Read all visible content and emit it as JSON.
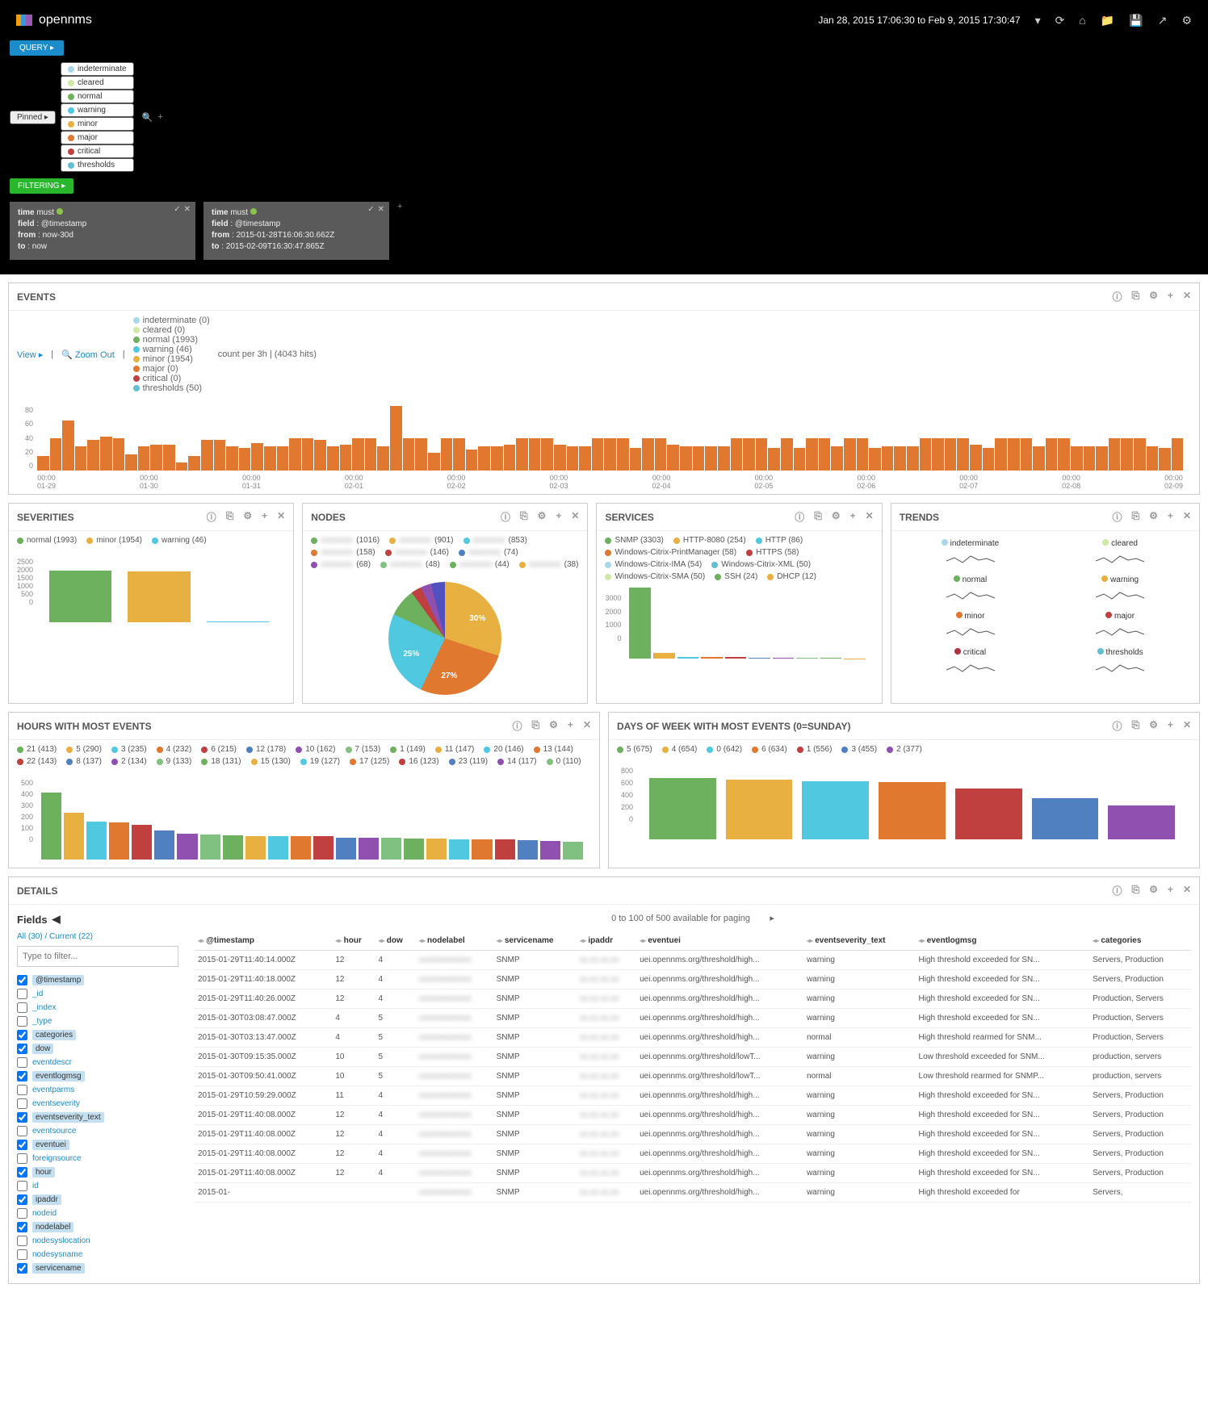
{
  "header": {
    "brand": "opennms",
    "time_range": "Jan 28, 2015 17:06:30 to Feb 9, 2015 17:30:47"
  },
  "buttons": {
    "query": "QUERY ▸",
    "filtering": "FILTERING ▸",
    "pinned": "Pinned ▸"
  },
  "severity_pills": [
    {
      "label": "indeterminate",
      "cls": "d-indet"
    },
    {
      "label": "cleared",
      "cls": "d-clear"
    },
    {
      "label": "normal",
      "cls": "d-norm"
    },
    {
      "label": "warning",
      "cls": "d-warn"
    },
    {
      "label": "minor",
      "cls": "d-minor"
    },
    {
      "label": "major",
      "cls": "d-major"
    },
    {
      "label": "critical",
      "cls": "d-crit"
    },
    {
      "label": "thresholds",
      "cls": "d-thresh"
    }
  ],
  "filters": [
    {
      "title": "time",
      "mode": "must",
      "lines": [
        [
          "field",
          "@timestamp"
        ],
        [
          "from",
          "now-30d"
        ],
        [
          "to",
          "now"
        ]
      ]
    },
    {
      "title": "time",
      "mode": "must",
      "lines": [
        [
          "field",
          "@timestamp"
        ],
        [
          "from",
          "2015-01-28T16:06:30.662Z"
        ],
        [
          "to",
          "2015-02-09T16:30:47.865Z"
        ]
      ]
    }
  ],
  "events_panel": {
    "title": "EVENTS",
    "view": "View ▸",
    "zoom": "🔍 Zoom Out",
    "legend": [
      {
        "label": "indeterminate (0)",
        "cls": "d-indet"
      },
      {
        "label": "cleared (0)",
        "cls": "d-clear"
      },
      {
        "label": "normal (1993)",
        "cls": "d-norm"
      },
      {
        "label": "warning (46)",
        "cls": "d-warn"
      },
      {
        "label": "minor (1954)",
        "cls": "d-minor"
      },
      {
        "label": "major (0)",
        "cls": "d-major"
      },
      {
        "label": "critical (0)",
        "cls": "d-crit"
      },
      {
        "label": "thresholds (50)",
        "cls": "d-thresh"
      }
    ],
    "count_text": "count per 3h | (4043 hits)"
  },
  "chart_data": {
    "events_timeline": {
      "type": "bar",
      "ylim": [
        0,
        80
      ],
      "yticks": [
        0,
        20,
        40,
        60,
        80
      ],
      "xticks": [
        "00:00",
        "01-29",
        "00:00",
        "01-30",
        "00:00",
        "01-31",
        "00:00",
        "02-01",
        "00:00",
        "02-02",
        "00:00",
        "02-03",
        "00:00",
        "02-04",
        "00:00",
        "02-05",
        "00:00",
        "02-06",
        "00:00",
        "02-07",
        "00:00",
        "02-08",
        "00:00",
        "02-09"
      ],
      "bars": [
        18,
        40,
        62,
        30,
        38,
        42,
        40,
        20,
        30,
        32,
        32,
        10,
        18,
        38,
        38,
        30,
        28,
        34,
        30,
        30,
        40,
        40,
        38,
        30,
        32,
        40,
        40,
        30,
        80,
        40,
        40,
        22,
        40,
        40,
        26,
        30,
        30,
        32,
        40,
        40,
        40,
        32,
        30,
        30,
        40,
        40,
        40,
        28,
        40,
        40,
        32,
        30,
        30,
        30,
        30,
        40,
        40,
        40,
        28,
        40,
        28,
        40,
        40,
        30,
        40,
        40,
        28,
        30,
        30,
        30,
        40,
        40,
        40,
        40,
        32,
        28,
        40,
        40,
        40,
        30,
        40,
        40,
        30,
        30,
        30,
        40,
        40,
        40,
        30,
        28,
        40
      ]
    },
    "severities": {
      "type": "bar",
      "ylim": [
        0,
        2500
      ],
      "yticks": [
        0,
        500,
        1000,
        1500,
        2000,
        2500
      ],
      "legend": [
        {
          "label": "normal (1993)",
          "cls": "d-norm"
        },
        {
          "label": "minor (1954)",
          "cls": "d-minor"
        },
        {
          "label": "warning (46)",
          "cls": "d-warn"
        }
      ],
      "series": [
        {
          "label": "normal",
          "value": 1993,
          "color": "#6db05d"
        },
        {
          "label": "minor",
          "value": 1954,
          "color": "#e8b040"
        },
        {
          "label": "warning",
          "value": 46,
          "color": "#50c8e0"
        }
      ]
    },
    "nodes": {
      "type": "pie",
      "legend": [
        "(1016)",
        "(901)",
        "(853)",
        "(158)",
        "(146)",
        "(74)",
        "(68)",
        "(48)",
        "(44)",
        "(38)"
      ],
      "slices": [
        {
          "pct": 30
        },
        {
          "pct": 27
        },
        {
          "pct": 25
        }
      ]
    },
    "services": {
      "type": "bar",
      "ylim": [
        0,
        3000
      ],
      "yticks": [
        0,
        1000,
        2000,
        3000
      ],
      "legend": [
        {
          "label": "SNMP (3303)",
          "cls": "d-norm"
        },
        {
          "label": "HTTP-8080 (254)",
          "cls": "d-minor"
        },
        {
          "label": "HTTP (86)",
          "cls": "d-warn"
        },
        {
          "label": "Windows-Citrix-PrintManager (58)",
          "cls": "d-major"
        },
        {
          "label": "HTTPS (58)",
          "cls": "d-crit"
        },
        {
          "label": "Windows-Citrix-IMA (54)",
          "cls": "d-indet"
        },
        {
          "label": "Windows-Citrix-XML (50)",
          "cls": "d-thresh"
        },
        {
          "label": "Windows-Citrix-SMA (50)",
          "cls": "d-clear"
        },
        {
          "label": "SSH (24)",
          "cls": "d-norm"
        },
        {
          "label": "DHCP (12)",
          "cls": "d-minor"
        }
      ],
      "series": [
        3303,
        254,
        86,
        58,
        58,
        54,
        50,
        50,
        24,
        12
      ],
      "colors": [
        "#6db05d",
        "#e8b040",
        "#50c8e0",
        "#e07830",
        "#c04040",
        "#5080c0",
        "#9050b0",
        "#80c080",
        "#6db05d",
        "#e8b040"
      ]
    },
    "hours": {
      "type": "bar",
      "ylim": [
        0,
        500
      ],
      "yticks": [
        0,
        100,
        200,
        300,
        400,
        500
      ],
      "legend": [
        "21 (413)",
        "5 (290)",
        "3 (235)",
        "4 (232)",
        "6 (215)",
        "12 (178)",
        "10 (162)",
        "7 (153)",
        "1 (149)",
        "11 (147)",
        "20 (146)",
        "13 (144)",
        "22 (143)",
        "8 (137)",
        "2 (134)",
        "9 (133)",
        "18 (131)",
        "15 (130)",
        "19 (127)",
        "17 (125)",
        "16 (123)",
        "23 (119)",
        "14 (117)",
        "0 (110)"
      ],
      "values": [
        413,
        290,
        235,
        232,
        215,
        178,
        162,
        153,
        149,
        147,
        146,
        144,
        143,
        137,
        134,
        133,
        131,
        130,
        127,
        125,
        123,
        119,
        117,
        110
      ],
      "colors": [
        "#6db05d",
        "#e8b040",
        "#50c8e0",
        "#e07830",
        "#c04040",
        "#5080c0",
        "#9050b0",
        "#80c080",
        "#6db05d",
        "#e8b040",
        "#50c8e0",
        "#e07830",
        "#c04040",
        "#5080c0",
        "#9050b0",
        "#80c080",
        "#6db05d",
        "#e8b040",
        "#50c8e0",
        "#e07830",
        "#c04040",
        "#5080c0",
        "#9050b0",
        "#80c080"
      ]
    },
    "dow": {
      "type": "bar",
      "ylim": [
        0,
        800
      ],
      "yticks": [
        0,
        200,
        400,
        600,
        800
      ],
      "legend": [
        {
          "label": "5 (675)"
        },
        {
          "label": "4 (654)"
        },
        {
          "label": "0 (642)"
        },
        {
          "label": "6 (634)"
        },
        {
          "label": "1 (556)"
        },
        {
          "label": "3 (455)"
        },
        {
          "label": "2 (377)"
        }
      ],
      "values": [
        675,
        654,
        642,
        634,
        556,
        455,
        377
      ],
      "colors": [
        "#6db05d",
        "#e8b040",
        "#50c8e0",
        "#e07830",
        "#c04040",
        "#5080c0",
        "#9050b0"
      ]
    },
    "trends": [
      "indeterminate",
      "cleared",
      "normal",
      "warning",
      "minor",
      "major",
      "critical",
      "thresholds"
    ]
  },
  "panels": {
    "severities": "SEVERITIES",
    "nodes": "NODES",
    "services": "SERVICES",
    "trends": "TRENDS",
    "hours": "HOURS WITH MOST EVENTS",
    "dow": "DAYS OF WEEK WITH MOST EVENTS (0=SUNDAY)",
    "details": "DETAILS"
  },
  "details": {
    "pager": "0 to 100 of 500 available for paging",
    "fields_title": "Fields",
    "fields_links": "All (30) / Current (22)",
    "filter_placeholder": "Type to filter...",
    "fields": [
      {
        "name": "@timestamp",
        "sel": true
      },
      {
        "name": "_id",
        "sel": false
      },
      {
        "name": "_index",
        "sel": false
      },
      {
        "name": "_type",
        "sel": false
      },
      {
        "name": "categories",
        "sel": true
      },
      {
        "name": "dow",
        "sel": true
      },
      {
        "name": "eventdescr",
        "sel": false
      },
      {
        "name": "eventlogmsg",
        "sel": true
      },
      {
        "name": "eventparms",
        "sel": false
      },
      {
        "name": "eventseverity",
        "sel": false
      },
      {
        "name": "eventseverity_text",
        "sel": true
      },
      {
        "name": "eventsource",
        "sel": false
      },
      {
        "name": "eventuei",
        "sel": true
      },
      {
        "name": "foreignsource",
        "sel": false
      },
      {
        "name": "hour",
        "sel": true
      },
      {
        "name": "id",
        "sel": false
      },
      {
        "name": "ipaddr",
        "sel": true
      },
      {
        "name": "nodeid",
        "sel": false
      },
      {
        "name": "nodelabel",
        "sel": true
      },
      {
        "name": "nodesyslocation",
        "sel": false
      },
      {
        "name": "nodesysname",
        "sel": false
      },
      {
        "name": "servicename",
        "sel": true
      }
    ],
    "columns": [
      "@timestamp",
      "hour",
      "dow",
      "nodelabel",
      "servicename",
      "ipaddr",
      "eventuei",
      "eventseverity_text",
      "eventlogmsg",
      "categories"
    ],
    "rows": [
      {
        "ts": "2015-01-29T11:40:14.000Z",
        "hour": "12",
        "dow": "4",
        "svc": "SNMP",
        "uei": "uei.opennms.org/threshold/high...",
        "sev": "warning",
        "msg": "High threshold exceeded for SN...",
        "cat": "Servers, Production"
      },
      {
        "ts": "2015-01-29T11:40:18.000Z",
        "hour": "12",
        "dow": "4",
        "svc": "SNMP",
        "uei": "uei.opennms.org/threshold/high...",
        "sev": "warning",
        "msg": "High threshold exceeded for SN...",
        "cat": "Servers, Production"
      },
      {
        "ts": "2015-01-29T11:40:26.000Z",
        "hour": "12",
        "dow": "4",
        "svc": "SNMP",
        "uei": "uei.opennms.org/threshold/high...",
        "sev": "warning",
        "msg": "High threshold exceeded for SN...",
        "cat": "Production, Servers"
      },
      {
        "ts": "2015-01-30T03:08:47.000Z",
        "hour": "4",
        "dow": "5",
        "svc": "SNMP",
        "uei": "uei.opennms.org/threshold/high...",
        "sev": "warning",
        "msg": "High threshold exceeded for SN...",
        "cat": "Production, Servers"
      },
      {
        "ts": "2015-01-30T03:13:47.000Z",
        "hour": "4",
        "dow": "5",
        "svc": "SNMP",
        "uei": "uei.opennms.org/threshold/high...",
        "sev": "normal",
        "msg": "High threshold rearmed for SNM...",
        "cat": "Production, Servers"
      },
      {
        "ts": "2015-01-30T09:15:35.000Z",
        "hour": "10",
        "dow": "5",
        "svc": "SNMP",
        "uei": "uei.opennms.org/threshold/lowT...",
        "sev": "warning",
        "msg": "Low threshold exceeded for SNM...",
        "cat": "production, servers"
      },
      {
        "ts": "2015-01-30T09:50:41.000Z",
        "hour": "10",
        "dow": "5",
        "svc": "SNMP",
        "uei": "uei.opennms.org/threshold/lowT...",
        "sev": "normal",
        "msg": "Low threshold rearmed for SNMP...",
        "cat": "production, servers"
      },
      {
        "ts": "2015-01-29T10:59:29.000Z",
        "hour": "11",
        "dow": "4",
        "svc": "SNMP",
        "uei": "uei.opennms.org/threshold/high...",
        "sev": "warning",
        "msg": "High threshold exceeded for SN...",
        "cat": "Servers, Production"
      },
      {
        "ts": "2015-01-29T11:40:08.000Z",
        "hour": "12",
        "dow": "4",
        "svc": "SNMP",
        "uei": "uei.opennms.org/threshold/high...",
        "sev": "warning",
        "msg": "High threshold exceeded for SN...",
        "cat": "Servers, Production"
      },
      {
        "ts": "2015-01-29T11:40:08.000Z",
        "hour": "12",
        "dow": "4",
        "svc": "SNMP",
        "uei": "uei.opennms.org/threshold/high...",
        "sev": "warning",
        "msg": "High threshold exceeded for SN...",
        "cat": "Servers, Production"
      },
      {
        "ts": "2015-01-29T11:40:08.000Z",
        "hour": "12",
        "dow": "4",
        "svc": "SNMP",
        "uei": "uei.opennms.org/threshold/high...",
        "sev": "warning",
        "msg": "High threshold exceeded for SN...",
        "cat": "Servers, Production"
      },
      {
        "ts": "2015-01-29T11:40:08.000Z",
        "hour": "12",
        "dow": "4",
        "svc": "SNMP",
        "uei": "uei.opennms.org/threshold/high...",
        "sev": "warning",
        "msg": "High threshold exceeded for SN...",
        "cat": "Servers, Production"
      },
      {
        "ts": "2015-01-",
        "hour": "",
        "dow": "",
        "svc": "SNMP",
        "uei": "uei.opennms.org/threshold/high...",
        "sev": "warning",
        "msg": "High threshold exceeded for",
        "cat": "Servers,"
      }
    ]
  }
}
